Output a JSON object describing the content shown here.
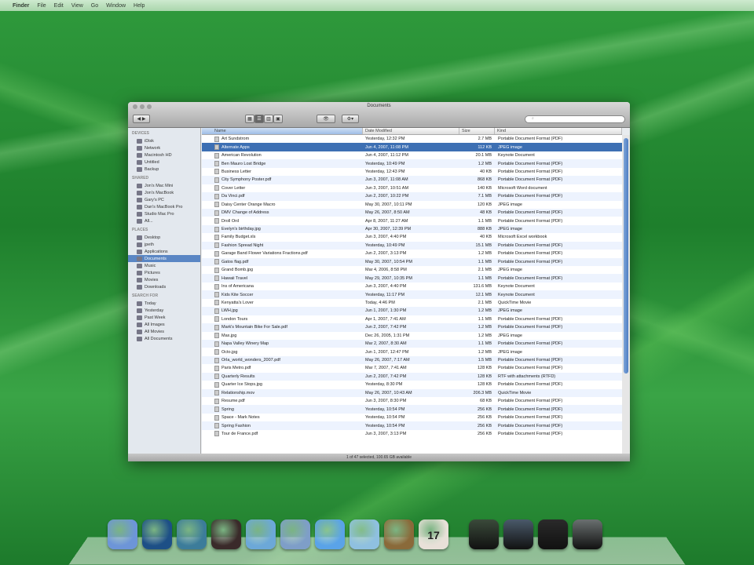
{
  "menubar": {
    "items": [
      "Finder",
      "File",
      "Edit",
      "View",
      "Go",
      "Window",
      "Help"
    ]
  },
  "window": {
    "title": "Documents",
    "search_placeholder": "",
    "view_buttons": [
      "icon-view",
      "list-view",
      "column-view",
      "coverflow-view"
    ],
    "action_buttons": [
      "eye-quicklook",
      "gear-action"
    ]
  },
  "sidebar": {
    "sections": [
      {
        "title": "DEVICES",
        "items": [
          "iDisk",
          "Network",
          "Macintosh HD",
          "Untitled",
          "Backup"
        ]
      },
      {
        "title": "SHARED",
        "items": [
          "Jon's Mac Mini",
          "Jon's MacBook",
          "Gary's PC",
          "Dan's MacBook Pro",
          "Studio Mac Pro",
          "All..."
        ]
      },
      {
        "title": "PLACES",
        "items": [
          "Desktop",
          "jpeth",
          "Applications",
          "Documents",
          "Music",
          "Pictures",
          "Movies",
          "Downloads"
        ]
      },
      {
        "title": "SEARCH FOR",
        "items": [
          "Today",
          "Yesterday",
          "Past Week",
          "All Images",
          "All Movies",
          "All Documents"
        ]
      }
    ],
    "selected": "Documents"
  },
  "list": {
    "columns": [
      "Name",
      "Date Modified",
      "Size",
      "Kind"
    ],
    "selected_index": 1,
    "rows": [
      [
        "Art Sundstrom",
        "Yesterday, 12:32 PM",
        "2.7 MB",
        "Portable Document Format (PDF)"
      ],
      [
        "Alternate Apps",
        "Jun 4, 2007, 11:08 PM",
        "112 KB",
        "JPEG image"
      ],
      [
        "American Revolution",
        "Jun 4, 2007, 11:12 PM",
        "20.1 MB",
        "Keynote Document"
      ],
      [
        "Ben Mauro Lost Bridge",
        "Yesterday, 10:49 PM",
        "1.2 MB",
        "Portable Document Format (PDF)"
      ],
      [
        "Business Letter",
        "Yesterday, 12:43 PM",
        "40 KB",
        "Portable Document Format (PDF)"
      ],
      [
        "City Symphony Poster.pdf",
        "Jun 3, 2007, 11:08 AM",
        "868 KB",
        "Portable Document Format (PDF)"
      ],
      [
        "Cover Letter",
        "Jun 3, 2007, 10:51 AM",
        "140 KB",
        "Microsoft Word document"
      ],
      [
        "Da Vinci.pdf",
        "Jun 2, 2007, 10:22 PM",
        "7.1 MB",
        "Portable Document Format (PDF)"
      ],
      [
        "Daisy Center Orange Macro",
        "May 30, 2007, 10:11 PM",
        "120 KB",
        "JPEG image"
      ],
      [
        "DMV Change of Address",
        "May 26, 2007, 8:50 AM",
        "48 KB",
        "Portable Document Format (PDF)"
      ],
      [
        "Droll Ord",
        "Apr 8, 2007, 11:27 AM",
        "1.1 MB",
        "Portable Document Format (PDF)"
      ],
      [
        "Evelyn's birthday.jpg",
        "Apr 30, 2007, 12:39 PM",
        "888 KB",
        "JPEG image"
      ],
      [
        "Family Budget.xls",
        "Jun 3, 2007, 4:40 PM",
        "40 KB",
        "Microsoft Excel workbook"
      ],
      [
        "Fashion Spread Night",
        "Yesterday, 10:49 PM",
        "15.1 MB",
        "Portable Document Format (PDF)"
      ],
      [
        "Garage Band Flower Variations Fractions.pdf",
        "Jun 2, 2007, 3:13 PM",
        "1.2 MB",
        "Portable Document Format (PDF)"
      ],
      [
        "Gatos flag.pdf",
        "May 30, 2007, 10:54 PM",
        "1.1 MB",
        "Portable Document Format (PDF)"
      ],
      [
        "Grand Bomb.jpg",
        "Mar 4, 2006, 8:58 PM",
        "2.1 MB",
        "JPEG image"
      ],
      [
        "Hawaii Travel",
        "May 29, 2007, 10:35 PM",
        "1.1 MB",
        "Portable Document Format (PDF)"
      ],
      [
        "Ins of Americana",
        "Jun 3, 2007, 4:40 PM",
        "131.6 MB",
        "Keynote Document"
      ],
      [
        "Kids Kite Soccer",
        "Yesterday, 11:17 PM",
        "12.1 MB",
        "Keynote Document"
      ],
      [
        "Kenyatta's Lover",
        "Today, 4:46 PM",
        "2.1 MB",
        "QuickTime Movie"
      ],
      [
        "LWH.jpg",
        "Jun 1, 2007, 1:30 PM",
        "1.2 MB",
        "JPEG image"
      ],
      [
        "London Tours",
        "Apr 1, 2007, 7:41 AM",
        "1.1 MB",
        "Portable Document Format (PDF)"
      ],
      [
        "Mark's Mountain Bike For Sale.pdf",
        "Jun 2, 2007, 7:42 PM",
        "1.2 MB",
        "Portable Document Format (PDF)"
      ],
      [
        "Max.jpg",
        "Dec 26, 2005, 1:31 PM",
        "1.2 MB",
        "JPEG image"
      ],
      [
        "Napa Valley Winery Map",
        "Mar 2, 2007, 8:30 AM",
        "1.1 MB",
        "Portable Document Format (PDF)"
      ],
      [
        "Octo.jpg",
        "Jun 1, 2007, 12:47 PM",
        "1.2 MB",
        "JPEG image"
      ],
      [
        "Orla_world_wonders_2007.pdf",
        "May 26, 2007, 7:17 AM",
        "1.5 MB",
        "Portable Document Format (PDF)"
      ],
      [
        "Paris Metro.pdf",
        "Mar 7, 2007, 7:41 AM",
        "128 KB",
        "Portable Document Format (PDF)"
      ],
      [
        "Quarterly Results",
        "Jun 2, 2007, 7:42 PM",
        "128 KB",
        "RTF with attachments (RTFD)"
      ],
      [
        "Quarter Ice Stops.jpg",
        "Yesterday, 8:30 PM",
        "128 KB",
        "Portable Document Format (PDF)"
      ],
      [
        "Relationship.mov",
        "May 26, 2007, 10:43 AM",
        "206.3 MB",
        "QuickTime Movie"
      ],
      [
        "Resume.pdf",
        "Jun 3, 2007, 8:30 PM",
        "68 KB",
        "Portable Document Format (PDF)"
      ],
      [
        "Spring",
        "Yesterday, 10:54 PM",
        "256 KB",
        "Portable Document Format (PDF)"
      ],
      [
        "Space - Mark Notes",
        "Yesterday, 10:54 PM",
        "256 KB",
        "Portable Document Format (PDF)"
      ],
      [
        "Spring Fashion",
        "Yesterday, 10:54 PM",
        "256 KB",
        "Portable Document Format (PDF)"
      ],
      [
        "Tour de France.pdf",
        "Jun 3, 2007, 3:13 PM",
        "256 KB",
        "Portable Document Format (PDF)"
      ]
    ]
  },
  "status": "1 of 47 selected, 100.65 GB available",
  "dock": {
    "apps": [
      {
        "name": "finder",
        "color": "#6d95d8"
      },
      {
        "name": "dashboard",
        "color": "#1d4f86"
      },
      {
        "name": "safari",
        "color": "#3c7c9a"
      },
      {
        "name": "time-machine",
        "color": "#3a2a2a"
      },
      {
        "name": "system-preferences",
        "color": "#6ca8d8"
      },
      {
        "name": "preview",
        "color": "#7e9ec8"
      },
      {
        "name": "ichat",
        "color": "#5aa3e8"
      },
      {
        "name": "itunes",
        "color": "#8fc0e0"
      },
      {
        "name": "iphoto",
        "color": "#8a6a3a"
      },
      {
        "name": "ical",
        "color": "#e8e0d8"
      }
    ],
    "stacks": [
      {
        "name": "stack-1",
        "color": "#3a4a3a"
      },
      {
        "name": "stack-2",
        "color": "#4a5a6a"
      },
      {
        "name": "stack-3",
        "color": "#2a2a2a"
      },
      {
        "name": "trash",
        "color": "#6a7070"
      }
    ],
    "calendar_day": "17"
  }
}
